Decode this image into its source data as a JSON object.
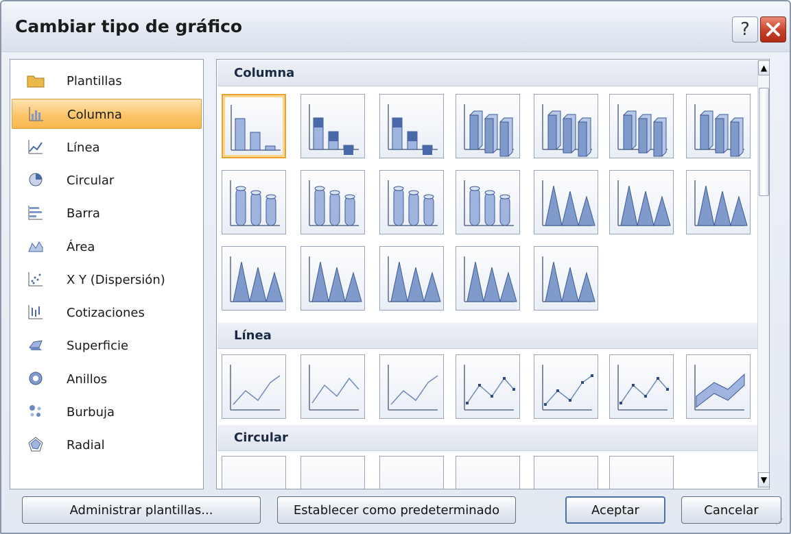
{
  "window": {
    "title": "Cambiar tipo de gráfico",
    "help_glyph": "?",
    "close_glyph": "✕"
  },
  "categories": [
    {
      "label": "Plantillas",
      "icon": "folder-icon"
    },
    {
      "label": "Columna",
      "icon": "column-chart-icon",
      "selected": true
    },
    {
      "label": "Línea",
      "icon": "line-chart-icon"
    },
    {
      "label": "Circular",
      "icon": "pie-chart-icon"
    },
    {
      "label": "Barra",
      "icon": "bar-chart-icon"
    },
    {
      "label": "Área",
      "icon": "area-chart-icon"
    },
    {
      "label": "X Y (Dispersión)",
      "icon": "scatter-chart-icon"
    },
    {
      "label": "Cotizaciones",
      "icon": "stock-chart-icon"
    },
    {
      "label": "Superficie",
      "icon": "surface-chart-icon"
    },
    {
      "label": "Anillos",
      "icon": "doughnut-chart-icon"
    },
    {
      "label": "Burbuja",
      "icon": "bubble-chart-icon"
    },
    {
      "label": "Radial",
      "icon": "radar-chart-icon"
    }
  ],
  "sections": {
    "columna": {
      "title": "Columna",
      "thumbnail_count": 19,
      "selected_index": 0
    },
    "linea": {
      "title": "Línea",
      "thumbnail_count": 7
    },
    "circular": {
      "title": "Circular",
      "thumbnail_count": 6
    }
  },
  "scrollbar": {
    "up_glyph": "▲",
    "down_glyph": "▼"
  },
  "buttons": {
    "manage_templates": "Administrar plantillas...",
    "set_default": "Establecer como predeterminado",
    "accept": "Aceptar",
    "cancel": "Cancelar"
  },
  "colors": {
    "selection": "#fbc56b",
    "accent_blue": "#5b79b0"
  }
}
